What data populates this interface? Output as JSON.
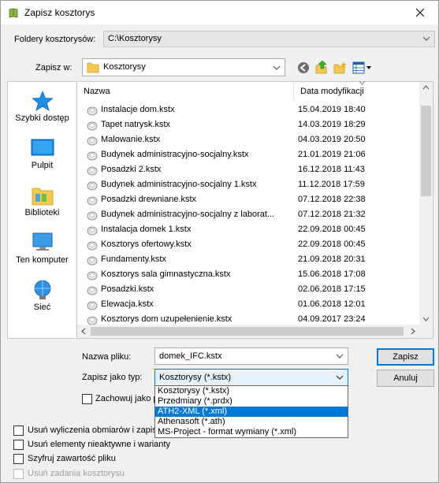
{
  "window": {
    "title": "Zapisz kosztorys"
  },
  "folders": {
    "label": "Foldery kosztorysów:",
    "value": "C:\\Kosztorysy"
  },
  "save_in": {
    "label": "Zapisz w:",
    "value": "Kosztorysy"
  },
  "places": [
    {
      "label": "Szybki dostęp"
    },
    {
      "label": "Pulpit"
    },
    {
      "label": "Biblioteki"
    },
    {
      "label": "Ten komputer"
    },
    {
      "label": "Sieć"
    }
  ],
  "columns": {
    "name": "Nazwa",
    "date": "Data modyfikacji"
  },
  "files": [
    {
      "name": "Instalacje dom.kstx",
      "date": "15.04.2019 18:40"
    },
    {
      "name": "Tapet natrysk.kstx",
      "date": "14.03.2019 18:29"
    },
    {
      "name": "Malowanie.kstx",
      "date": "04.03.2019 20:50"
    },
    {
      "name": "Budynek administracyjno-socjalny.kstx",
      "date": "21.01.2019 21:06"
    },
    {
      "name": "Posadzki 2.kstx",
      "date": "16.12.2018 11:43"
    },
    {
      "name": "Budynek administracyjno-socjalny 1.kstx",
      "date": "11.12.2018 17:59"
    },
    {
      "name": "Posadzki drewniane.kstx",
      "date": "07.12.2018 22:38"
    },
    {
      "name": "Budynek administracyjno-socjalny z laborat...",
      "date": "07.12.2018 21:32"
    },
    {
      "name": "Instalacja domek 1.kstx",
      "date": "22.09.2018 00:45"
    },
    {
      "name": "Kosztorys ofertowy.kstx",
      "date": "22.09.2018 00:45"
    },
    {
      "name": "Fundamenty.kstx",
      "date": "21.09.2018 20:31"
    },
    {
      "name": "Kosztorys sala gimnastyczna.kstx",
      "date": "15.06.2018 17:08"
    },
    {
      "name": "Posadzki.kstx",
      "date": "02.06.2018 17:15"
    },
    {
      "name": "Elewacja.kstx",
      "date": "01.06.2018 12:01"
    },
    {
      "name": "Kosztorys dom uzupełenienie.kstx",
      "date": "04.09.2017 23:24"
    }
  ],
  "filename": {
    "label": "Nazwa pliku:",
    "value": "domek_IFC.kstx"
  },
  "filetype": {
    "label": "Zapisz jako typ:",
    "value": "Kosztorysy (*.kstx)",
    "options": [
      "Kosztorysy (*.kstx)",
      "Przedmiary (*.prdx)",
      "ATH2-XML (*.xml)",
      "Athenasoft (*.ath)",
      "MS-Project - format wymiany (*.xml)"
    ],
    "highlighted_index": 2
  },
  "buttons": {
    "save": "Zapisz",
    "cancel": "Anuluj"
  },
  "checkboxes": {
    "keep": "Zachowuj jako p",
    "remove_calcs": "Usuń wyliczenia obmiarów i zapisz",
    "remove_inactive": "Usuń elementy nieaktywne i warianty",
    "encrypt": "Szyfruj zawartość pliku",
    "remove_tasks": "Usuń zadania kosztorysu"
  }
}
